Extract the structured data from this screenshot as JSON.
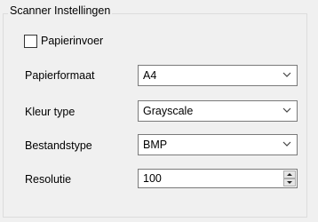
{
  "group": {
    "title": "Scanner Instellingen"
  },
  "paper_feed": {
    "label": "Papierinvoer",
    "checked": false
  },
  "fields": {
    "paper_size": {
      "label": "Papierformaat",
      "value": "A4"
    },
    "color_type": {
      "label": "Kleur type",
      "value": "Grayscale"
    },
    "file_type": {
      "label": "Bestandstype",
      "value": "BMP"
    },
    "resolution": {
      "label": "Resolutie",
      "value": "100"
    }
  },
  "icons": {
    "combo_arrow": "chevron-down-icon",
    "spin_up": "triangle-up-icon",
    "spin_down": "triangle-down-icon"
  }
}
